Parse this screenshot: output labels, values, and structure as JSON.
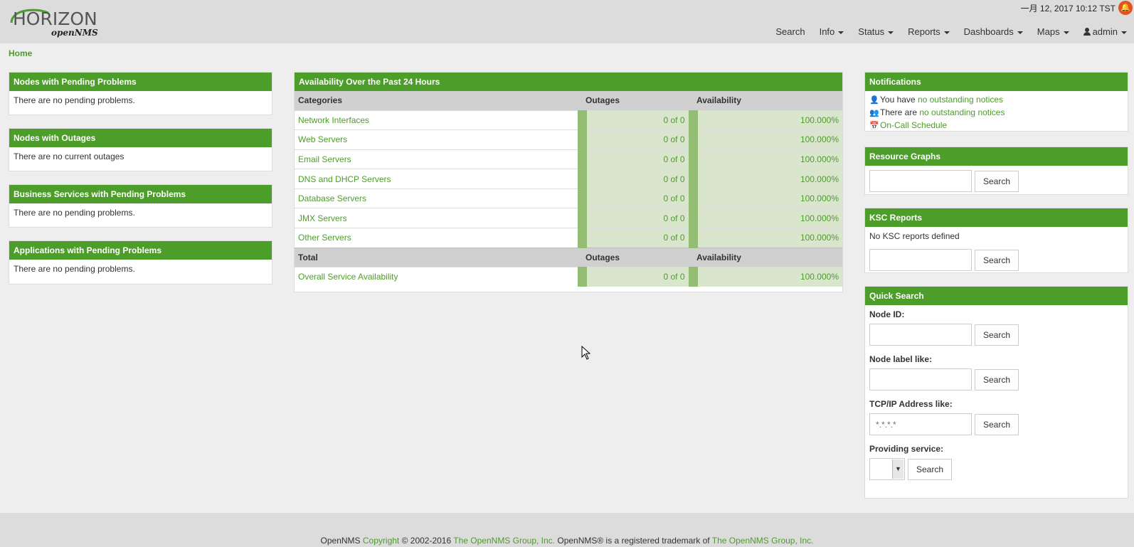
{
  "header": {
    "logo_main": "HORIZON",
    "logo_sub": "openNMS",
    "datetime": "一月 12, 2017 10:12 TST",
    "nav": [
      {
        "label": "Search",
        "dropdown": false
      },
      {
        "label": "Info",
        "dropdown": true
      },
      {
        "label": "Status",
        "dropdown": true
      },
      {
        "label": "Reports",
        "dropdown": true
      },
      {
        "label": "Dashboards",
        "dropdown": true
      },
      {
        "label": "Maps",
        "dropdown": true
      }
    ],
    "user": "admin"
  },
  "breadcrumb": "Home",
  "left_panels": {
    "pending": {
      "title": "Nodes with Pending Problems",
      "body": "There are no pending problems."
    },
    "outages": {
      "title": "Nodes with Outages",
      "body": "There are no current outages"
    },
    "business": {
      "title": "Business Services with Pending Problems",
      "body": "There are no pending problems."
    },
    "applications": {
      "title": "Applications with Pending Problems",
      "body": "There are no pending problems."
    }
  },
  "availability": {
    "title": "Availability Over the Past 24 Hours",
    "headers": {
      "categories": "Categories",
      "outages": "Outages",
      "availability": "Availability"
    },
    "rows": [
      {
        "name": "Network Interfaces",
        "outages": "0 of 0",
        "availability": "100.000%"
      },
      {
        "name": "Web Servers",
        "outages": "0 of 0",
        "availability": "100.000%"
      },
      {
        "name": "Email Servers",
        "outages": "0 of 0",
        "availability": "100.000%"
      },
      {
        "name": "DNS and DHCP Servers",
        "outages": "0 of 0",
        "availability": "100.000%"
      },
      {
        "name": "Database Servers",
        "outages": "0 of 0",
        "availability": "100.000%"
      },
      {
        "name": "JMX Servers",
        "outages": "0 of 0",
        "availability": "100.000%"
      },
      {
        "name": "Other Servers",
        "outages": "0 of 0",
        "availability": "100.000%"
      }
    ],
    "total_headers": {
      "total": "Total",
      "outages": "Outages",
      "availability": "Availability"
    },
    "total_row": {
      "name": "Overall Service Availability",
      "outages": "0 of 0",
      "availability": "100.000%"
    }
  },
  "notifications": {
    "title": "Notifications",
    "line1_prefix": "You have",
    "line1_link": "no outstanding notices",
    "line2_prefix": "There are",
    "line2_link": "no outstanding notices",
    "oncall": "On-Call Schedule"
  },
  "resource_graphs": {
    "title": "Resource Graphs",
    "button": "Search"
  },
  "ksc": {
    "title": "KSC Reports",
    "body": "No KSC reports defined",
    "button": "Search"
  },
  "quick_search": {
    "title": "Quick Search",
    "node_id_label": "Node ID:",
    "node_label_label": "Node label like:",
    "ip_label": "TCP/IP Address like:",
    "ip_placeholder": "*.*.*.*",
    "service_label": "Providing service:",
    "button": "Search"
  },
  "footer": {
    "prefix": "OpenNMS",
    "copyright_link": "Copyright",
    "years": "© 2002-2016",
    "group1": "The OpenNMS Group, Inc.",
    "middle": "OpenNMS® is a registered trademark of",
    "group2": "The OpenNMS Group, Inc."
  },
  "colors": {
    "brand_green": "#4c9d29",
    "header_gray": "#dcdcdc",
    "availability_fill": "#d9e6cd"
  }
}
